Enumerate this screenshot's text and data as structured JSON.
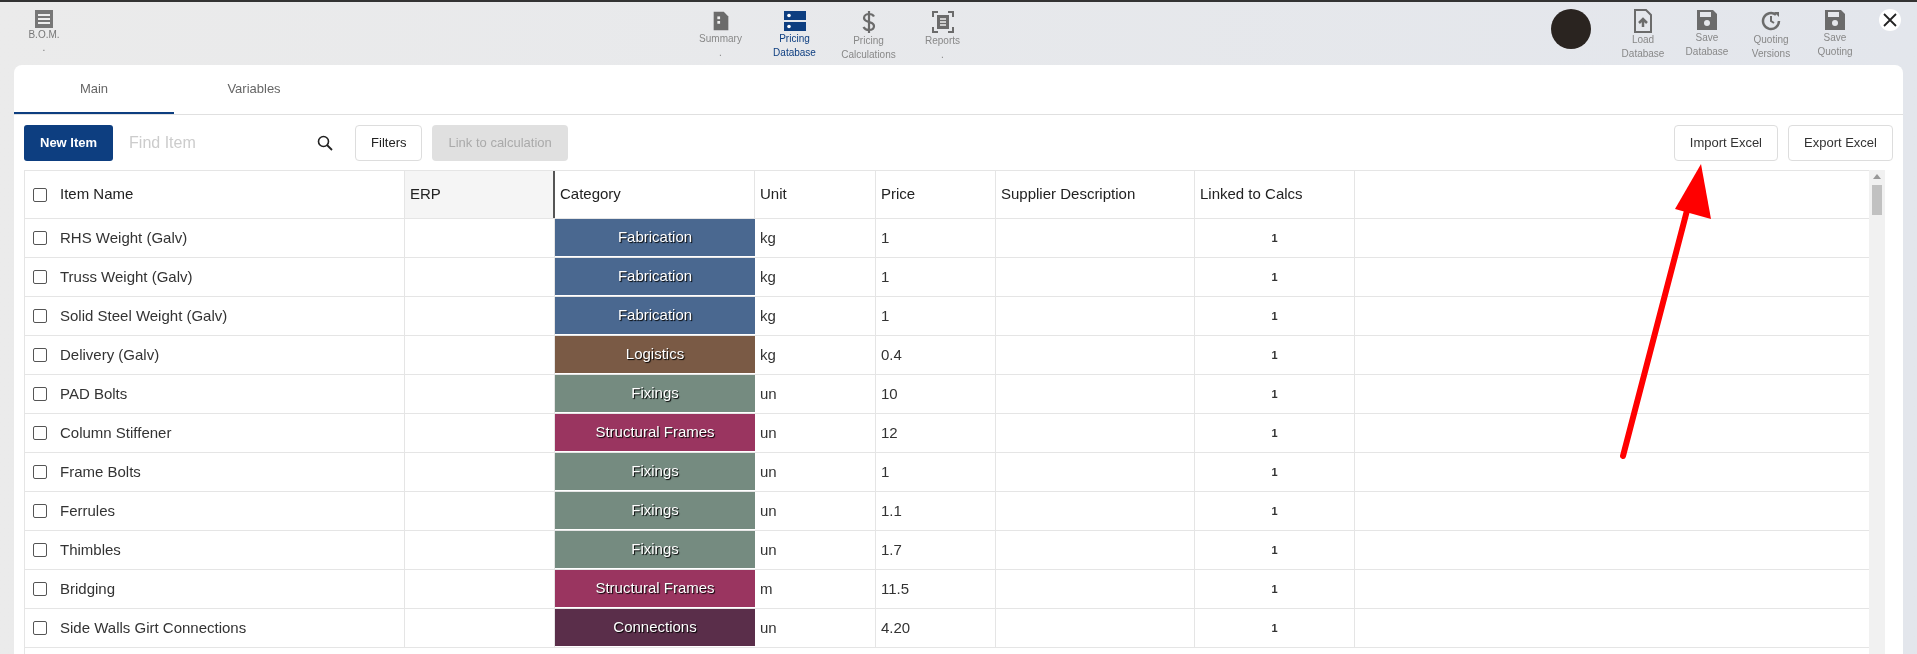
{
  "left_nav": {
    "label": "B.O.M.",
    "note": "."
  },
  "center_nav": [
    {
      "lines": [
        "Summary",
        "."
      ],
      "selected": false
    },
    {
      "lines": [
        "Pricing",
        "Database"
      ],
      "selected": true
    },
    {
      "lines": [
        "Pricing",
        "Calculations"
      ],
      "selected": false
    },
    {
      "lines": [
        "Reports",
        "."
      ],
      "selected": false
    }
  ],
  "right_nav": [
    {
      "lines": [
        "Load",
        "Database"
      ]
    },
    {
      "lines": [
        "Save",
        "Database"
      ]
    },
    {
      "lines": [
        "Quoting",
        "Versions"
      ]
    },
    {
      "lines": [
        "Save",
        "Quoting"
      ]
    }
  ],
  "tabs": [
    {
      "label": "Main",
      "selected": true
    },
    {
      "label": "Variables",
      "selected": false
    }
  ],
  "toolbar": {
    "new_button": "New Item",
    "search": {
      "placeholder": "Find Item"
    },
    "filters_button": "Filters",
    "link_button": {
      "label": "Link to calculation",
      "disabled": true
    },
    "import_button": "Import Excel",
    "export_button": "Export Excel"
  },
  "table": {
    "select_all_checked": false,
    "columns": [
      "Item Name",
      "ERP",
      "Category",
      "Unit",
      "Price",
      "Supplier Description",
      "Linked to Calcs"
    ],
    "rows": [
      {
        "checked": false,
        "name": "RHS Weight (Galv)",
        "category": {
          "label": "Fabrication",
          "color": "#4a6890"
        },
        "unit": "kg",
        "price": "1",
        "linked": "1"
      },
      {
        "checked": false,
        "name": "Truss Weight (Galv)",
        "category": {
          "label": "Fabrication",
          "color": "#4a6890"
        },
        "unit": "kg",
        "price": "1",
        "linked": "1"
      },
      {
        "checked": false,
        "name": "Solid Steel Weight (Galv)",
        "category": {
          "label": "Fabrication",
          "color": "#4a6890"
        },
        "unit": "kg",
        "price": "1",
        "linked": "1"
      },
      {
        "checked": false,
        "name": "Delivery (Galv)",
        "category": {
          "label": "Logistics",
          "color": "#7a5a45"
        },
        "unit": "kg",
        "price": "0.4",
        "linked": "1"
      },
      {
        "checked": false,
        "name": "PAD Bolts",
        "category": {
          "label": "Fixings",
          "color": "#758b80"
        },
        "unit": "un",
        "price": "10",
        "linked": "1"
      },
      {
        "checked": false,
        "name": "Column Stiffener",
        "category": {
          "label": "Structural Frames",
          "color": "#9a3560"
        },
        "unit": "un",
        "price": "12",
        "linked": "1"
      },
      {
        "checked": false,
        "name": "Frame Bolts",
        "category": {
          "label": "Fixings",
          "color": "#758b80"
        },
        "unit": "un",
        "price": "1",
        "linked": "1"
      },
      {
        "checked": false,
        "name": "Ferrules",
        "category": {
          "label": "Fixings",
          "color": "#758b80"
        },
        "unit": "un",
        "price": "1.1",
        "linked": "1"
      },
      {
        "checked": false,
        "name": "Thimbles",
        "category": {
          "label": "Fixings",
          "color": "#758b80"
        },
        "unit": "un",
        "price": "1.7",
        "linked": "1"
      },
      {
        "checked": false,
        "name": "Bridging",
        "category": {
          "label": "Structural Frames",
          "color": "#9a3560"
        },
        "unit": "m",
        "price": "11.5",
        "linked": "1"
      },
      {
        "checked": false,
        "name": "Side Walls Girt Connections",
        "category": {
          "label": "Connections",
          "color": "#5a2e4a"
        },
        "unit": "un",
        "price": "4.20",
        "linked": "1"
      }
    ]
  }
}
